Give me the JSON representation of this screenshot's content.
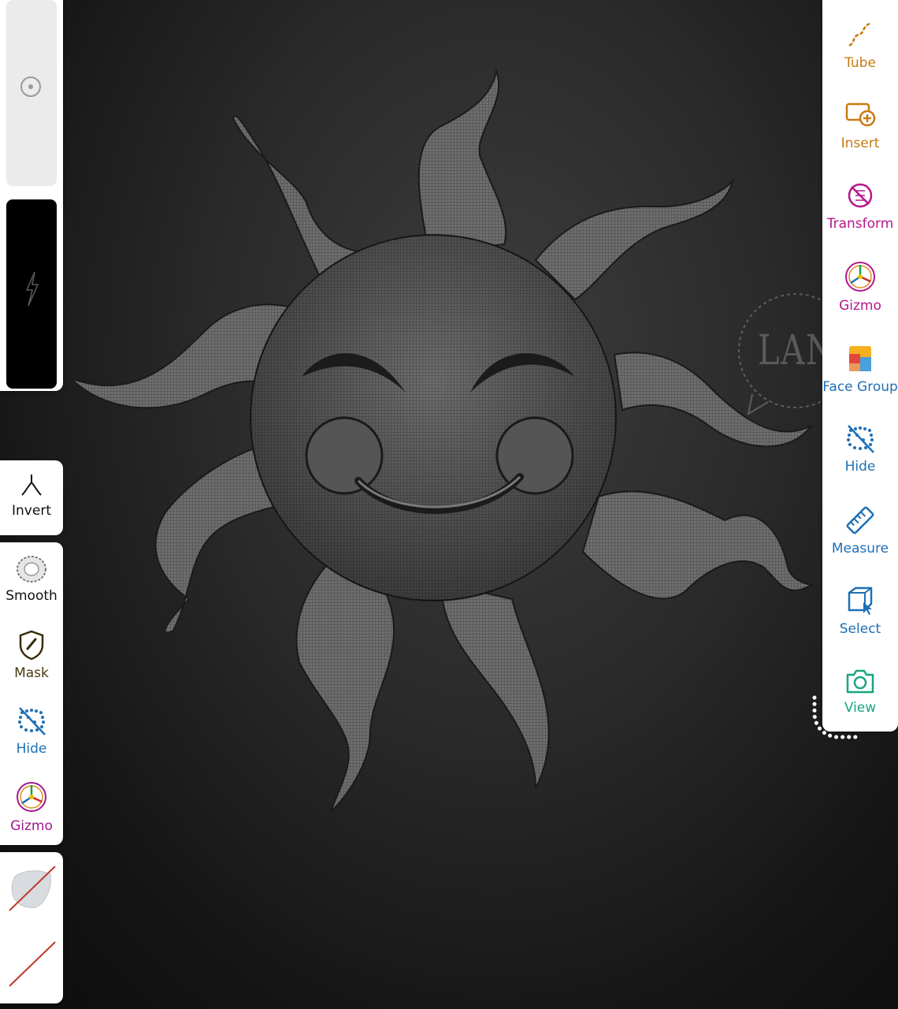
{
  "left_panel": {
    "tools": [
      {
        "label": "Invert",
        "icon": "invert-icon",
        "color": "#111111"
      },
      {
        "label": "Smooth",
        "icon": "smooth-icon",
        "color": "#111111"
      },
      {
        "label": "Mask",
        "icon": "mask-icon",
        "color": "#4a3a10"
      },
      {
        "label": "Hide",
        "icon": "hide-icon",
        "color": "#1f6fb5"
      },
      {
        "label": "Gizmo",
        "icon": "gizmo-icon",
        "color": "#a0198f"
      }
    ],
    "sliders": [
      {
        "name": "radius-slider",
        "icon": "target-icon"
      },
      {
        "name": "intensity-slider",
        "icon": "lightning-icon"
      }
    ]
  },
  "right_panel": {
    "tools": [
      {
        "label": "Tube",
        "icon": "tube-icon",
        "color": "#c77a12"
      },
      {
        "label": "Insert",
        "icon": "insert-icon",
        "color": "#c77a12"
      },
      {
        "label": "Transform",
        "icon": "transform-icon",
        "color": "#b5178c"
      },
      {
        "label": "Gizmo",
        "icon": "gizmo-icon",
        "color": "#b5178c"
      },
      {
        "label": "Face Group",
        "icon": "face-group-icon",
        "color": "#1f6fb5"
      },
      {
        "label": "Hide",
        "icon": "hide-icon",
        "color": "#1f6fb5"
      },
      {
        "label": "Measure",
        "icon": "measure-icon",
        "color": "#1f6fb5"
      },
      {
        "label": "Select",
        "icon": "select-icon",
        "color": "#1f6fb5"
      },
      {
        "label": "View",
        "icon": "camera-icon",
        "color": "#19a67e"
      }
    ]
  },
  "watermark": {
    "text": "LANE"
  }
}
